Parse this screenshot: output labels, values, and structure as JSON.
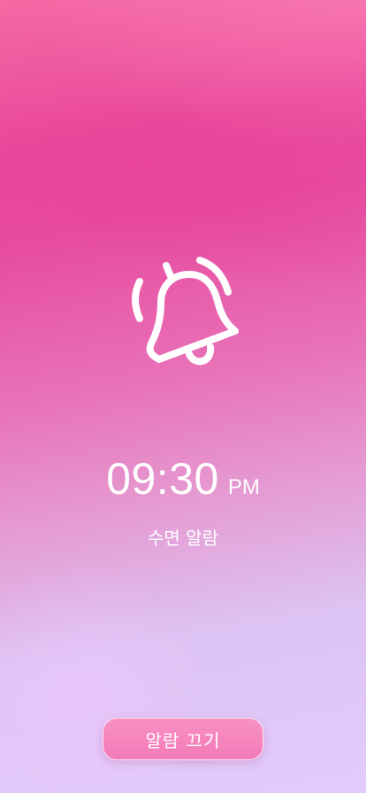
{
  "alarm": {
    "time": "09:30",
    "period": "PM",
    "label": "수면 알람"
  },
  "actions": {
    "dismiss_label": "알람 끄기"
  },
  "icons": {
    "bell": "bell-ringing-icon"
  },
  "colors": {
    "gradient_top": "#e9479b",
    "gradient_bottom": "#e2cbfb",
    "button_fill": "#f27bb7",
    "text": "#ffffff"
  }
}
